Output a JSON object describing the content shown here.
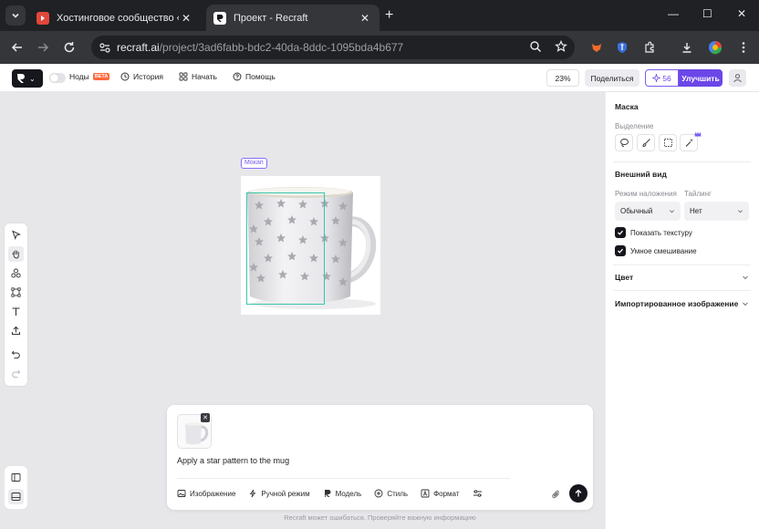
{
  "browser": {
    "tabs": [
      {
        "title": "Хостинговое сообщество «Tim",
        "active": false
      },
      {
        "title": "Проект - Recraft",
        "active": true
      }
    ],
    "url_host": "recraft.ai",
    "url_path": "/project/3ad6fabb-bdc2-40da-8ddc-1095bda4b677"
  },
  "topbar": {
    "nodes_label": "Ноды",
    "beta_badge": "BETA",
    "history_label": "История",
    "start_label": "Начать",
    "help_label": "Помощь",
    "zoom": "23%",
    "share_label": "Поделиться",
    "credits": "56",
    "upgrade_label": "Улучшить"
  },
  "canvas": {
    "mockup_label": "Мокап"
  },
  "panel": {
    "mask_title": "Маска",
    "selection_label": "Выделение",
    "appearance_title": "Внешний вид",
    "blend_label": "Режим наложения",
    "tiling_label": "Тайлинг",
    "blend_value": "Обычный",
    "tiling_value": "Нет",
    "show_texture_label": "Показать текстуру",
    "smart_blend_label": "Умное смешивание",
    "color_title": "Цвет",
    "imported_title": "Импортированное изображение"
  },
  "prompt": {
    "text": "Apply a star pattern to the mug",
    "tools": [
      "Изображение",
      "Ручной режим",
      "Модель",
      "Стиль",
      "Формат"
    ],
    "disclaimer": "Recraft может ошибаться. Проверяйте важную информацию"
  },
  "colors": {
    "accent": "#6b47e8",
    "selection": "#39c6ad",
    "beta": "#ff6a3d"
  }
}
